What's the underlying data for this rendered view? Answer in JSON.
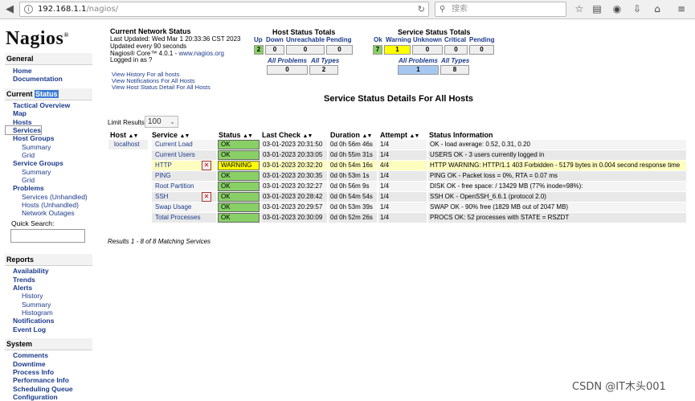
{
  "browser": {
    "url_host": "192.168.1.1",
    "url_path": "/nagios/",
    "search_placeholder": "搜索"
  },
  "sidebar": {
    "logo": "Nagios",
    "logo_mark": "®",
    "general": {
      "title": "General",
      "items": [
        "Home",
        "Documentation"
      ]
    },
    "current": {
      "title_a": "Current",
      "title_b": "Status",
      "items": {
        "tactical": "Tactical Overview",
        "map": "Map",
        "hosts": "Hosts",
        "services": "Services",
        "host_groups": "Host Groups",
        "hg_summary": "Summary",
        "hg_grid": "Grid",
        "service_groups": "Service Groups",
        "sg_summary": "Summary",
        "sg_grid": "Grid",
        "problems": "Problems",
        "p_services": "Services",
        "p_services_un": "Unhandled",
        "p_hosts": "Hosts",
        "p_hosts_un": "Unhandled",
        "p_outages": "Network Outages"
      }
    },
    "quick_search": "Quick Search:",
    "reports": {
      "title": "Reports",
      "items": {
        "availability": "Availability",
        "trends": "Trends",
        "alerts": "Alerts",
        "history": "History",
        "summary": "Summary",
        "histogram": "Histogram",
        "notifications": "Notifications",
        "eventlog": "Event Log"
      }
    },
    "system": {
      "title": "System",
      "items": {
        "comments": "Comments",
        "downtime": "Downtime",
        "process": "Process Info",
        "performance": "Performance Info",
        "scheduling": "Scheduling Queue",
        "configuration": "Configuration"
      }
    }
  },
  "status": {
    "title": "Current Network Status",
    "last_updated": "Last Updated: Wed Mar 1 20:33:36 CST 2023",
    "interval": "Updated every 90 seconds",
    "core_prefix": "Nagios® Core™ 4.0.1 - ",
    "core_link": "www.nagios.org",
    "logged_in": "Logged in as ?",
    "links": [
      "View History For all hosts",
      "View Notifications For All Hosts",
      "View Host Status Detail For All Hosts"
    ]
  },
  "host_totals": {
    "title": "Host Status Totals",
    "labels": [
      "Up",
      "Down",
      "Unreachable",
      "Pending"
    ],
    "values": [
      "2",
      "0",
      "0",
      "0"
    ],
    "all_labels": [
      "All Problems",
      "All Types"
    ],
    "all_values": [
      "0",
      "2"
    ]
  },
  "service_totals": {
    "title": "Service Status Totals",
    "labels": [
      "Ok",
      "Warning",
      "Unknown",
      "Critical",
      "Pending"
    ],
    "values": [
      "7",
      "1",
      "0",
      "0",
      "0"
    ],
    "all_labels": [
      "All Problems",
      "All Types"
    ],
    "all_values": [
      "1",
      "8"
    ]
  },
  "page_title": "Service Status Details For All Hosts",
  "limit": {
    "label": "Limit Results:",
    "value": "100"
  },
  "table": {
    "headers": [
      "Host",
      "Service",
      "Status",
      "Last Check",
      "Duration",
      "Attempt",
      "Status Information"
    ],
    "rows": [
      {
        "host": "localhost",
        "service": "Current Load",
        "status": "OK",
        "last": "03-01-2023 20:31:50",
        "duration": "0d 0h 56m 46s",
        "attempt": "1/4",
        "info": "OK - load average: 0.52, 0.31, 0.20"
      },
      {
        "host": "",
        "service": "Current Users",
        "status": "OK",
        "last": "03-01-2023 20:33:05",
        "duration": "0d 0h 55m 31s",
        "attempt": "1/4",
        "info": "USERS OK - 3 users currently logged in"
      },
      {
        "host": "",
        "service": "HTTP",
        "status": "WARNING",
        "last": "03-01-2023 20:32:20",
        "duration": "0d 0h 54m 16s",
        "attempt": "4/4",
        "info": "HTTP WARNING: HTTP/1.1 403 Forbidden - 5179 bytes in 0.004 second response time"
      },
      {
        "host": "",
        "service": "PING",
        "status": "OK",
        "last": "03-01-2023 20:30:35",
        "duration": "0d 0h 53m 1s",
        "attempt": "1/4",
        "info": "PING OK - Packet loss = 0%, RTA = 0.07 ms"
      },
      {
        "host": "",
        "service": "Root Partition",
        "status": "OK",
        "last": "03-01-2023 20:32:27",
        "duration": "0d 0h 56m 9s",
        "attempt": "1/4",
        "info": "DISK OK - free space: / 13429 MB (77% inode=98%):"
      },
      {
        "host": "",
        "service": "SSH",
        "status": "OK",
        "last": "03-01-2023 20:28:42",
        "duration": "0d 0h 54m 54s",
        "attempt": "1/4",
        "info": "SSH OK - OpenSSH_6.6.1 (protocol 2.0)"
      },
      {
        "host": "",
        "service": "Swap Usage",
        "status": "OK",
        "last": "03-01-2023 20:29:57",
        "duration": "0d 0h 53m 39s",
        "attempt": "1/4",
        "info": "SWAP OK - 90% free (1829 MB out of 2047 MB)"
      },
      {
        "host": "",
        "service": "Total Processes",
        "status": "OK",
        "last": "03-01-2023 20:30:09",
        "duration": "0d 0h 52m 26s",
        "attempt": "1/4",
        "info": "PROCS OK: 52 processes with STATE = RSZDT"
      }
    ]
  },
  "results_line": "Results 1 - 8 of 8 Matching Services",
  "watermark": "CSDN @IT木头001",
  "colors": {
    "ok": "#88d066",
    "warning": "#ffff00",
    "link": "#1a3a8a",
    "selected_total": "#a6c8f0"
  }
}
